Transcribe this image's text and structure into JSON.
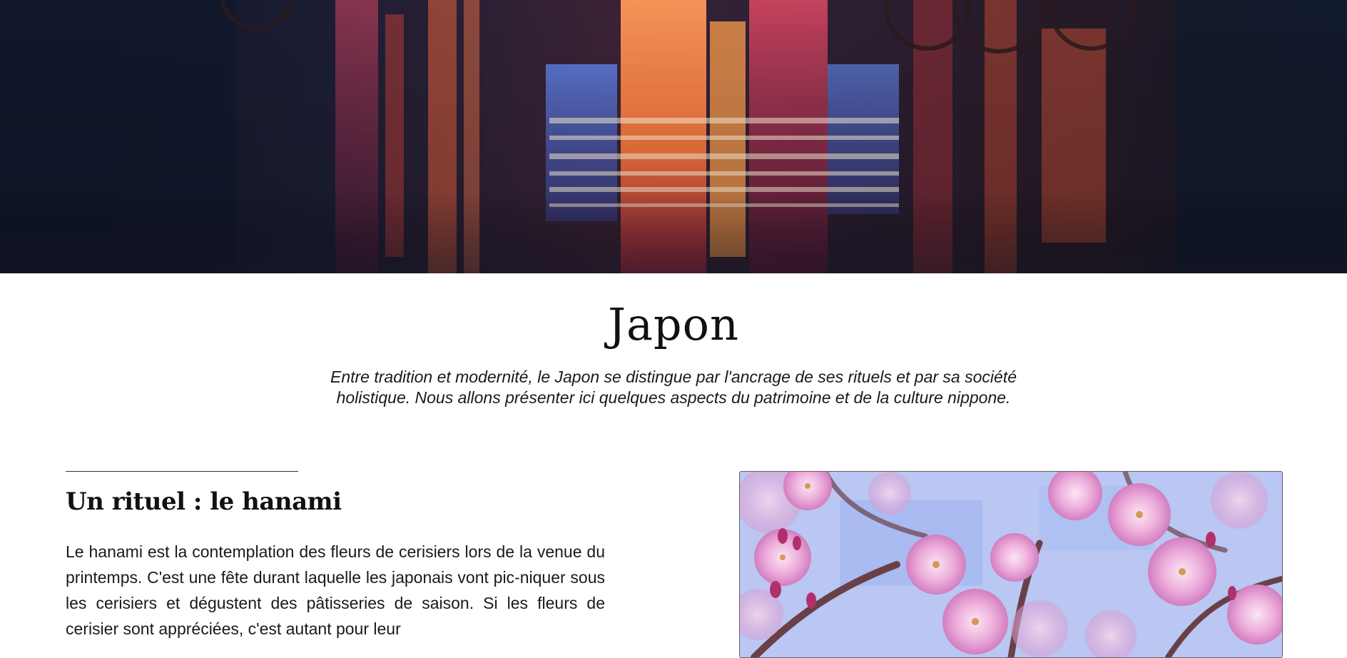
{
  "page": {
    "title": "Japon",
    "intro": "Entre tradition et modernité, le Japon se distingue par l'ancrage de ses rituels et par sa société holistique. Nous allons présenter ici quelques aspects du patrimoine et de la culture nippone."
  },
  "section": {
    "title": "Un rituel : le hanami",
    "text": "Le hanami est la contemplation des fleurs de cerisiers lors de la venue du printemps. C'est une fête durant laquelle les japonais vont pic-niquer sous les cerisiers et dégustent des pâtisseries de saison. Si les fleurs de cerisier sont appréciées, c'est autant pour leur"
  },
  "images": {
    "hero": "city-night-reflection-image",
    "section_photo": "cherry-blossom-image"
  },
  "colors": {
    "hero_dark": "#161a2e",
    "blossom_pink": "#e7a6d9",
    "sky_blue": "#b9c7f2"
  }
}
